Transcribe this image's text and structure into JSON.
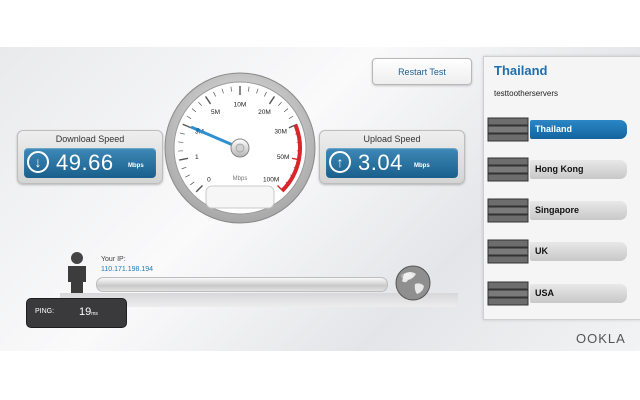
{
  "app": {
    "brand": "OOKLA",
    "restart_label": "Restart Test"
  },
  "download": {
    "label": "Download Speed",
    "value": "49.66",
    "unit": "Mbps",
    "icon": "arrow-down-icon"
  },
  "upload": {
    "label": "Upload Speed",
    "value": "3.04",
    "unit": "Mbps",
    "icon": "arrow-up-icon"
  },
  "gauge": {
    "unit": "Mbps",
    "ticks": [
      "0",
      "1",
      "3M",
      "5M",
      "10M",
      "20M",
      "30M",
      "50M",
      "100M"
    ],
    "needle_value_mbps": 3.04,
    "needle_color": "#2f8fd0",
    "redline_color": "#d9262c"
  },
  "connection": {
    "ip_label": "Your IP:",
    "ip_value": "110.171.198.194",
    "ping_label": "PING:",
    "ping_value": "19",
    "ping_unit": "ms"
  },
  "servers": {
    "title": "Thailand",
    "subtitle": "testtootherservers",
    "items": [
      {
        "label": "Thailand",
        "active": true
      },
      {
        "label": "Hong Kong",
        "active": false
      },
      {
        "label": "Singapore",
        "active": false
      },
      {
        "label": "UK",
        "active": false
      },
      {
        "label": "USA",
        "active": false
      }
    ]
  },
  "colors": {
    "accent": "#1d6fb0",
    "value_box": "#1a5f8c"
  }
}
